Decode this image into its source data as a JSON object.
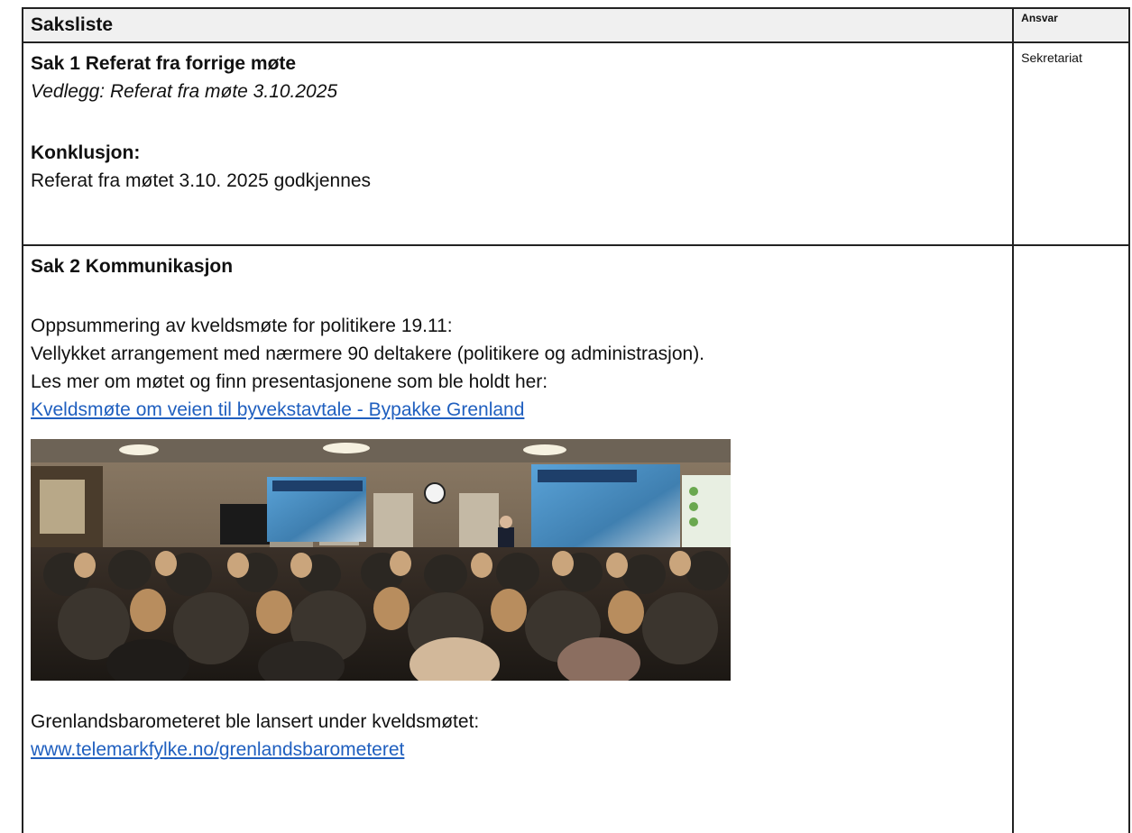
{
  "table": {
    "header_title": "Saksliste",
    "header_responsible": "Ansvar"
  },
  "sak1": {
    "title": "Sak 1 Referat fra forrige møte",
    "attachment_label": "Vedlegg",
    "attachment_value": ": Referat fra møte 3.10.2025",
    "conclusion_label": "Konklusjon:",
    "conclusion_text": "Referat fra møtet 3.10. 2025 godkjennes",
    "responsible": "Sekretariat"
  },
  "sak2": {
    "title": "Sak 2 Kommunikasjon",
    "line1": "Oppsummering av kveldsmøte for politikere 19.11:",
    "line2": "Vellykket arrangement med nærmere 90 deltakere (politikere og administrasjon).",
    "line3": "Les mer om møtet og finn presentasjonene som ble holdt her:",
    "link1": "Kveldsmøte om veien til byvekstavtale - Bypakke Grenland",
    "line4": "Grenlandsbarometeret ble lansert under kveldsmøtet:",
    "link2": "www.telemarkfylke.no/grenlandsbarometeret",
    "responsible": ""
  },
  "colors": {
    "link": "#1f5fbf",
    "border": "#222222",
    "header_bg": "#f0f0f0"
  }
}
